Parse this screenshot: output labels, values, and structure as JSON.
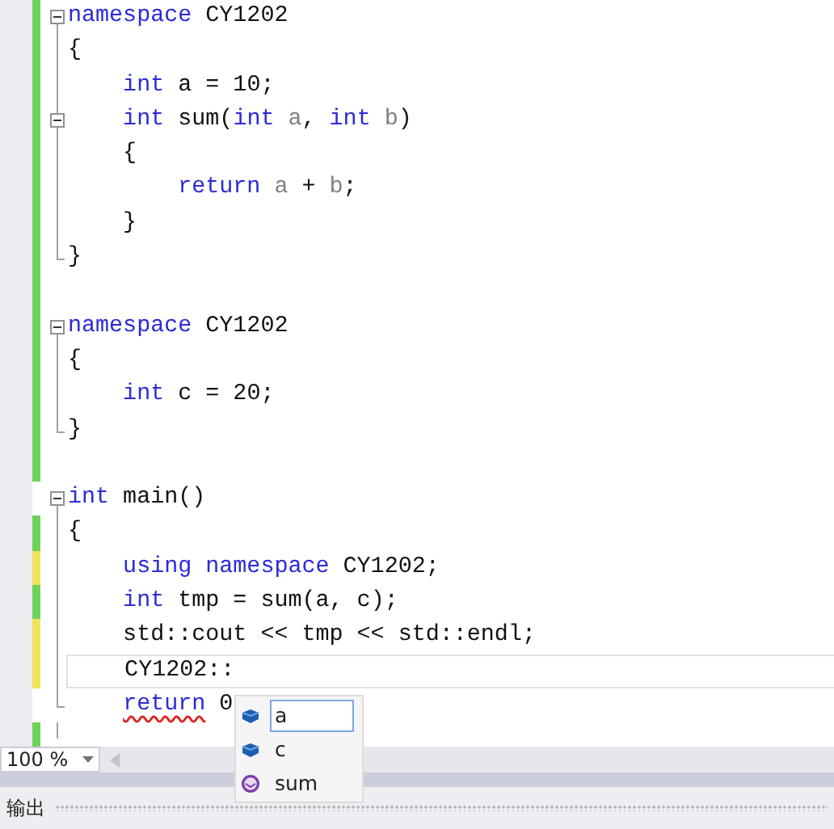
{
  "lines": [
    {
      "color": "#6ed35a",
      "foldable": true,
      "tokens": [
        {
          "kind": "keyword",
          "text": "namespace"
        },
        {
          "kind": "plain",
          "text": " CY1202"
        }
      ]
    },
    {
      "color": "#6ed35a",
      "foldable": false,
      "tokens": [
        {
          "kind": "plain",
          "text": "{"
        }
      ]
    },
    {
      "color": "#6ed35a",
      "foldable": false,
      "tokens": [
        {
          "kind": "keyword",
          "text": "    int"
        },
        {
          "kind": "plain",
          "text": " a = 10;"
        }
      ]
    },
    {
      "color": "#6ed35a",
      "foldable": true,
      "tokens": [
        {
          "kind": "keyword",
          "text": "    int"
        },
        {
          "kind": "plain",
          "text": " sum("
        },
        {
          "kind": "keyword",
          "text": "int"
        },
        {
          "kind": "param",
          "text": " a"
        },
        {
          "kind": "plain",
          "text": ", "
        },
        {
          "kind": "keyword",
          "text": "int"
        },
        {
          "kind": "param",
          "text": " b"
        },
        {
          "kind": "plain",
          "text": ")"
        }
      ]
    },
    {
      "color": "#6ed35a",
      "foldable": false,
      "tokens": [
        {
          "kind": "plain",
          "text": "    {"
        }
      ]
    },
    {
      "color": "#6ed35a",
      "foldable": false,
      "tokens": [
        {
          "kind": "keyword",
          "text": "        return"
        },
        {
          "kind": "param",
          "text": " a"
        },
        {
          "kind": "plain",
          "text": " + "
        },
        {
          "kind": "param",
          "text": "b"
        },
        {
          "kind": "plain",
          "text": ";"
        }
      ]
    },
    {
      "color": "#6ed35a",
      "foldable": false,
      "tokens": [
        {
          "kind": "plain",
          "text": "    }"
        }
      ]
    },
    {
      "color": "#6ed35a",
      "foldable": false,
      "tokens": [
        {
          "kind": "plain",
          "text": "}"
        }
      ]
    },
    {
      "color": "#6ed35a",
      "foldable": false
    },
    {
      "color": "#6ed35a",
      "foldable": true,
      "tokens": [
        {
          "kind": "keyword",
          "text": "namespace"
        },
        {
          "kind": "plain",
          "text": " CY1202"
        }
      ]
    },
    {
      "color": "#6ed35a",
      "foldable": false,
      "tokens": [
        {
          "kind": "plain",
          "text": "{"
        }
      ]
    },
    {
      "color": "#6ed35a",
      "foldable": false,
      "tokens": [
        {
          "kind": "keyword",
          "text": "    int"
        },
        {
          "kind": "plain",
          "text": " c = 20;"
        }
      ]
    },
    {
      "color": "#6ed35a",
      "foldable": false,
      "tokens": [
        {
          "kind": "plain",
          "text": "}"
        }
      ]
    },
    {
      "color": "#6ed35a",
      "foldable": false
    },
    {
      "foldable": true,
      "tokens": [
        {
          "kind": "keyword",
          "text": "int"
        },
        {
          "kind": "plain",
          "text": " main()"
        }
      ]
    },
    {
      "color": "#6ed35a",
      "foldable": false,
      "tokens": [
        {
          "kind": "plain",
          "text": "{"
        }
      ]
    },
    {
      "color": "#f1e35a",
      "foldable": false,
      "tokens": [
        {
          "kind": "keyword",
          "text": "    using namespace"
        },
        {
          "kind": "plain",
          "text": " CY1202;"
        }
      ]
    },
    {
      "color": "#6ed35a",
      "foldable": false,
      "tokens": [
        {
          "kind": "keyword",
          "text": "    int"
        },
        {
          "kind": "plain",
          "text": " tmp = sum(a, c);"
        }
      ]
    },
    {
      "color": "#f1e35a",
      "foldable": false,
      "tokens": [
        {
          "kind": "plain",
          "text": "    std::cout << tmp << std::endl;"
        }
      ]
    },
    {
      "color": "#f1e35a",
      "foldable": false,
      "current": true,
      "tokens": [
        {
          "kind": "plain",
          "text": "    CY1202::"
        }
      ]
    },
    {
      "foldable": false,
      "tokens": [
        {
          "kind": "error-keyword",
          "text": "    return"
        },
        {
          "kind": "plain",
          "text": " 0"
        }
      ]
    },
    {
      "color": "#6ed35a",
      "foldable": false
    }
  ],
  "completion": [
    {
      "kind": "field",
      "label": "a",
      "selected": true
    },
    {
      "kind": "field",
      "label": "c",
      "selected": false
    },
    {
      "kind": "method",
      "label": "sum",
      "selected": false
    }
  ],
  "zoom": "100 %",
  "panel_tab": "输出"
}
